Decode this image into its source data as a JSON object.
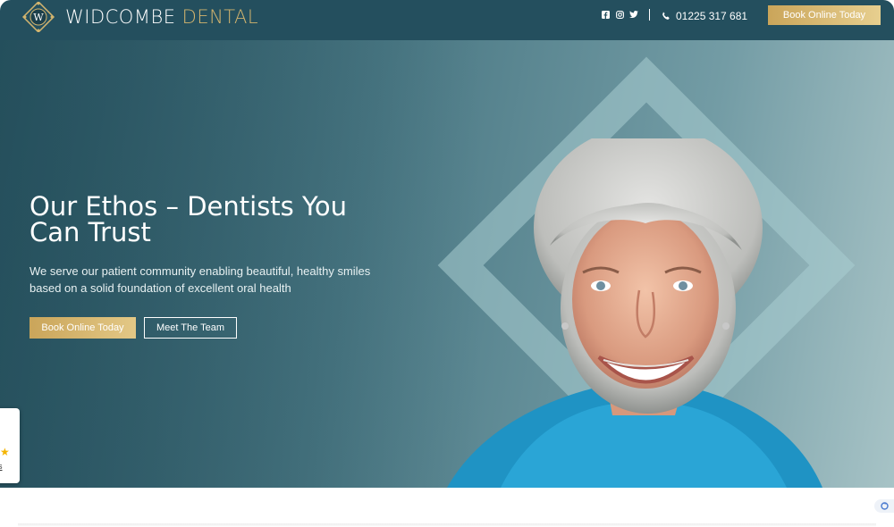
{
  "header": {
    "logo_mark": "W",
    "brand_primary": "WIDCOMBE",
    "brand_secondary": "DENTAL",
    "social_icons": [
      "facebook-icon",
      "instagram-icon",
      "twitter-icon"
    ],
    "phone": "01225 317 681",
    "book_button": "Book Online Today"
  },
  "hero": {
    "title": "Our Ethos – Dentists You Can Trust",
    "subtitle": "We serve our patient community enabling beautiful, healthy smiles based on a solid foundation of excellent oral health",
    "primary_button": "Book Online Today",
    "secondary_button": "Meet The Team"
  },
  "review_widget": {
    "link_text": "s"
  },
  "colors": {
    "header_bg": "#244f5e",
    "gold_accent": "#d2b46e",
    "hero_dark": "#2b5866",
    "hero_light": "#a7c3c6"
  }
}
